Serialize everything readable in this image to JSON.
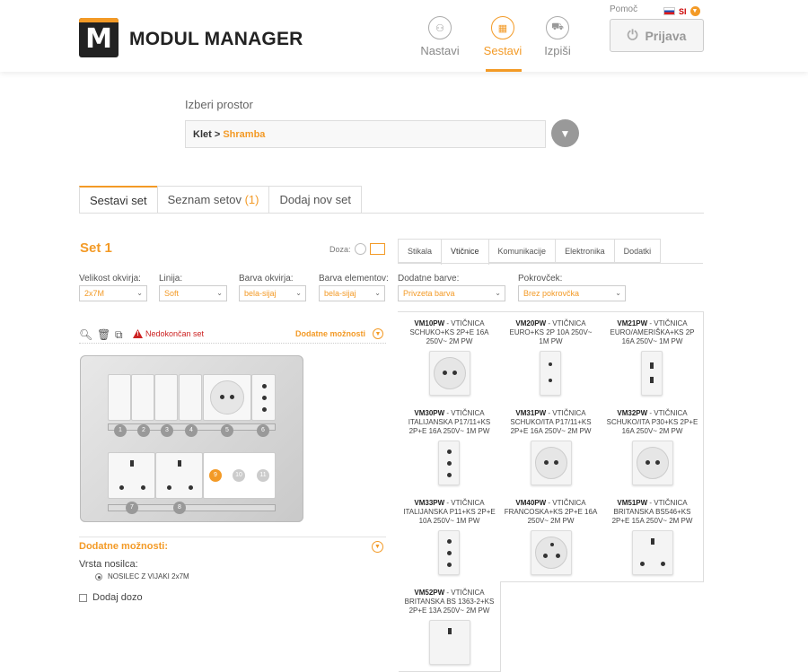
{
  "header": {
    "logo_letter": "M",
    "app_title": "MODUL MANAGER",
    "nav": [
      {
        "label": "Nastavi",
        "icon": "sitemap-icon"
      },
      {
        "label": "Sestavi",
        "icon": "grid-icon",
        "active": true
      },
      {
        "label": "Izpiši",
        "icon": "cart-icon"
      }
    ],
    "help": "Pomoč",
    "lang": "SI",
    "login_label": "Prijava"
  },
  "room": {
    "label": "Izberi prostor",
    "crumb_parent": "Klet",
    "crumb_sep": " > ",
    "crumb_active": "Shramba"
  },
  "tabs": {
    "build": "Sestavi set",
    "list": "Seznam setov",
    "list_count": "(1)",
    "add": "Dodaj nov set"
  },
  "set": {
    "title": "Set 1",
    "doza_label": "Doza:",
    "fields": [
      {
        "label": "Velikost okvirja:",
        "value": "2x7M"
      },
      {
        "label": "Linija:",
        "value": "Soft"
      },
      {
        "label": "Barva okvirja:",
        "value": "bela-sijaj"
      },
      {
        "label": "Barva elementov:",
        "value": "bela-sijaj"
      }
    ],
    "warning": "Nedokončan set",
    "more_options": "Dodatne možnosti",
    "slot_numbers": [
      "1",
      "2",
      "3",
      "4",
      "5",
      "6",
      "7",
      "8",
      "9",
      "10",
      "11"
    ]
  },
  "options": {
    "title": "Dodatne možnosti:",
    "carrier_label": "Vrsta nosilca:",
    "carrier_value": "NOSILEC Z VIJAKI 2x7M",
    "add_box": "Dodaj dozo"
  },
  "product_tabs": [
    "Stikala",
    "Vtičnice",
    "Komunikacije",
    "Elektronika",
    "Dodatki"
  ],
  "filters": [
    {
      "label": "Dodatne barve:",
      "value": "Privzeta barva"
    },
    {
      "label": "Pokrovček:",
      "value": "Brez pokrovčka"
    }
  ],
  "products": [
    {
      "code": "VM10PW",
      "desc": " - VTIČNICA SCHUKO+KS 2P+E 16A 250V~ 2M PW"
    },
    {
      "code": "VM20PW",
      "desc": " - VTIČNICA EURO+KS 2P 10A 250V~ 1M PW"
    },
    {
      "code": "VM21PW",
      "desc": " - VTIČNICA EURO/AMERIŠKA+KS 2P 16A 250V~ 1M PW"
    },
    {
      "code": "VM30PW",
      "desc": " - VTIČNICA ITALIJANSKA P17/11+KS 2P+E 16A 250V~ 1M PW"
    },
    {
      "code": "VM31PW",
      "desc": " - VTIČNICA SCHUKO/ITA P17/11+KS 2P+E 16A 250V~ 2M PW"
    },
    {
      "code": "VM32PW",
      "desc": " - VTIČNICA SCHUKO/ITA P30+KS 2P+E 16A 250V~ 2M PW"
    },
    {
      "code": "VM33PW",
      "desc": " - VTIČNICA ITALIJANSKA P11+KS 2P+E 10A 250V~ 1M PW"
    },
    {
      "code": "VM40PW",
      "desc": " - VTIČNICA FRANCOSKA+KS 2P+E 16A 250V~ 2M PW"
    },
    {
      "code": "VM51PW",
      "desc": " - VTIČNICA BRITANSKA BS546+KS 2P+E 15A 250V~ 2M PW"
    },
    {
      "code": "VM52PW",
      "desc": " - VTIČNICA BRITANSKA BS 1363-2+KS 2P+E 13A 250V~ 2M PW"
    }
  ],
  "colors": {
    "accent": "#f39a26",
    "warning": "#cc2222"
  }
}
